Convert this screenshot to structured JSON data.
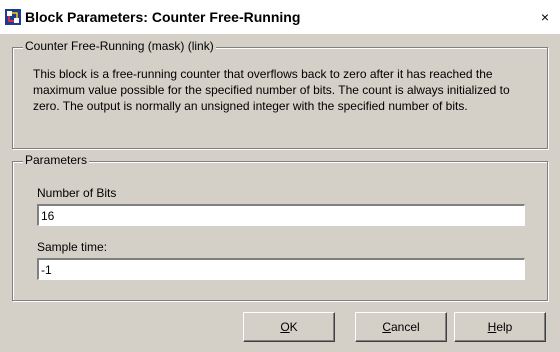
{
  "window": {
    "title": "Block Parameters: Counter Free-Running",
    "close_glyph": "×",
    "icon_name": "simulink-block-icon"
  },
  "description_group": {
    "legend": "Counter Free-Running (mask) (link)",
    "text": "This block is a free-running counter that overflows back to zero after it has reached the maximum value possible for the specified number of bits. The count is always initialized to zero.  The output is normally an unsigned integer with the specified number of bits."
  },
  "parameters_group": {
    "legend": "Parameters",
    "fields": [
      {
        "label": "Number of Bits",
        "value": "16"
      },
      {
        "label": "Sample time:",
        "value": "-1"
      }
    ]
  },
  "buttons": {
    "ok": {
      "mnemonic": "O",
      "rest": "K"
    },
    "cancel": {
      "mnemonic": "C",
      "rest": "ancel"
    },
    "help": {
      "mnemonic": "H",
      "rest": "elp"
    }
  }
}
